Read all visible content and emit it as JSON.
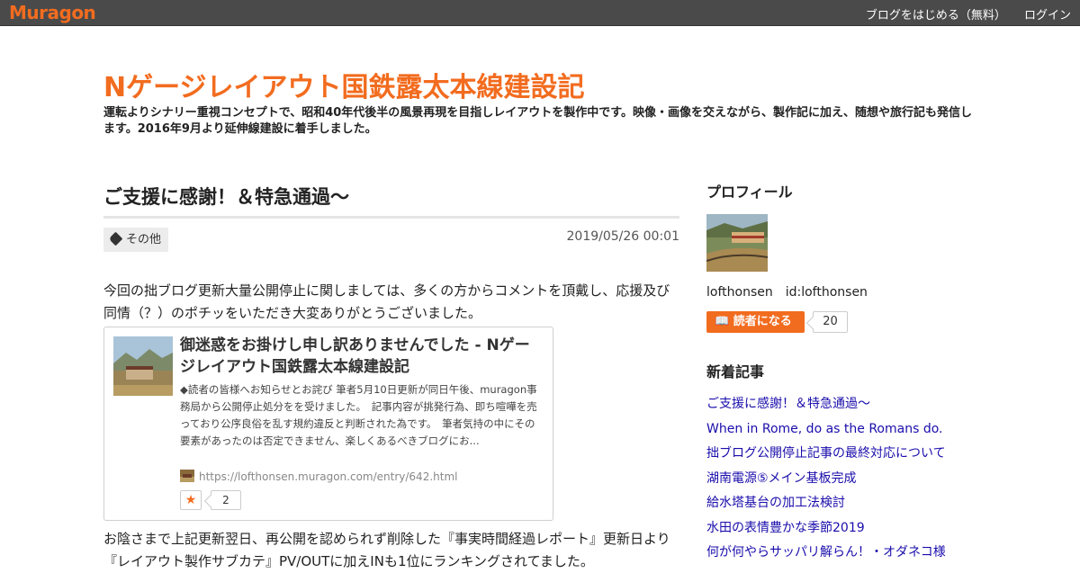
{
  "topbar": {
    "logo": "Muragon",
    "start_blog": "ブログをはじめる（無料）",
    "login": "ログイン"
  },
  "blog": {
    "title": "Nゲージレイアウト国鉄露太本線建設記",
    "description": "運転よりシナリー重視コンセプトで、昭和40年代後半の風景再現を目指しレイアウトを製作中です。映像・画像を交えながら、製作記に加え、随想や旅行記も発信します。2016年9月より延伸線建設に着手しました。"
  },
  "article": {
    "title": "ご支援に感謝！＆特急通過～",
    "tag": "その他",
    "date": "2019/05/26 00:01",
    "paragraph1": "今回の拙ブログ更新大量公開停止に関しましては、多くの方からコメントを頂戴し、応援及び同情（？）のポチッをいただき大変ありがとうございました。",
    "card": {
      "title": "御迷惑をお掛けし申し訳ありませんでした - Nゲージレイアウト国鉄露太本線建設記",
      "body": "◆読者の皆様へお知らせとお詫び 筆者5月10日更新が同日午後、muragon事務局から公開停止処分をを受けました。　記事内容が挑発行為、即ち喧嘩を売っており公序良俗を乱す規約違反と判断された為です。　筆者気持の中にその要素があったのは否定できません、楽しくあるべきブログにお...",
      "url": "https://lofthonsen.muragon.com/entry/642.html",
      "star_count": "2"
    },
    "paragraph2": "お陰さまで上記更新翌日、再公開を認められず削除した『事実時間経過レポート』更新日より『レイアウト製作サブカテ』PV/OUTに加えINも1位にランキングされてました。"
  },
  "sidebar": {
    "profile_heading": "プロフィール",
    "profile_name": "lofthonsen　id:lofthonsen",
    "reader_button": "読者になる",
    "reader_count": "20",
    "recent_heading": "新着記事",
    "recent": [
      "ご支援に感謝！＆特急通過～",
      "When in Rome, do as the Romans do.",
      "拙ブログ公開停止記事の最終対応について",
      "湖南電源⑤メイン基板完成",
      "給水塔基台の加工法検討",
      "水田の表情豊かな季節2019",
      "何が何やらサッパリ解らん！・オダネコ様"
    ]
  },
  "colors": {
    "accent": "#f26c1f",
    "link": "#1a0dab",
    "topbar": "#4a4a4a"
  }
}
